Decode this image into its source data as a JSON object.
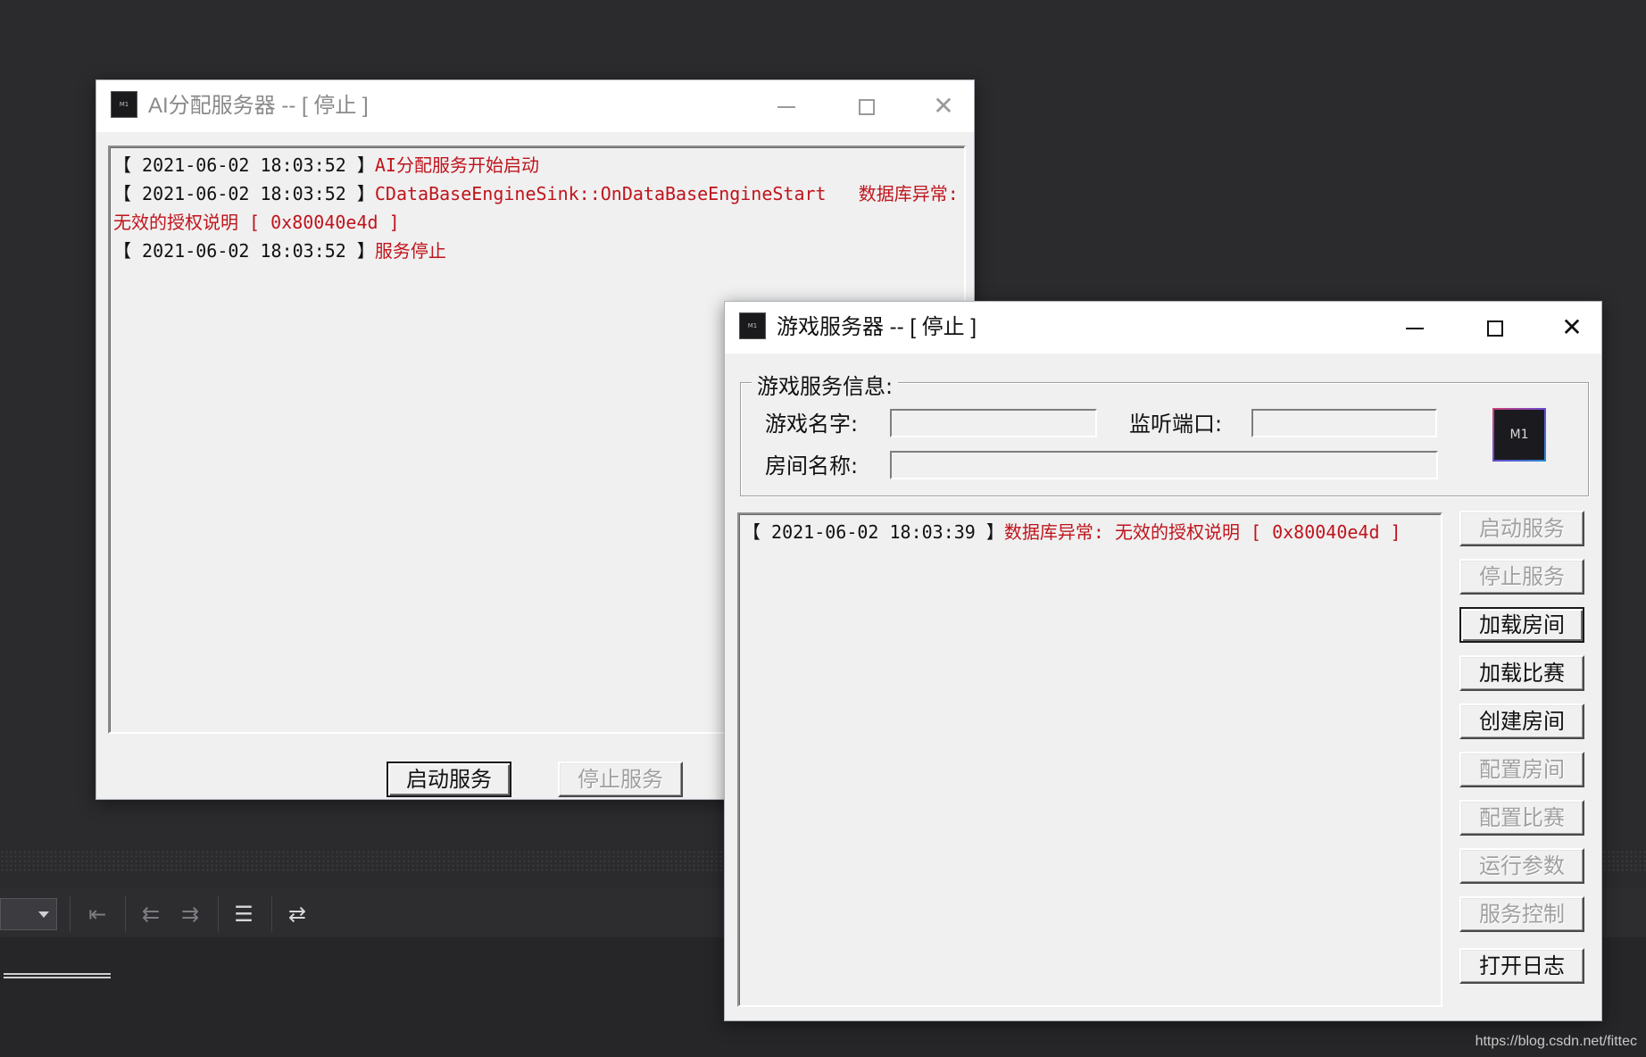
{
  "ai_window": {
    "title": "AI分配服务器 -- [ 停止 ]",
    "log": [
      {
        "ts": "【 2021-06-02 18:03:52 】",
        "msg": "AI分配服务开始启动"
      },
      {
        "ts": "【 2021-06-02 18:03:52 】",
        "msg": "CDataBaseEngineSink::OnDataBaseEngineStart   数据库异常: 无效的授权说明 [ 0x80040e4d ]"
      },
      {
        "ts": "【 2021-06-02 18:03:52 】",
        "msg": "服务停止"
      }
    ],
    "buttons": {
      "start": "启动服务",
      "stop": "停止服务"
    }
  },
  "game_window": {
    "title": "游戏服务器 -- [ 停止 ]",
    "group_title": "游戏服务信息:",
    "labels": {
      "game_name": "游戏名字:",
      "listen_port": "监听端口:",
      "room_name": "房间名称:"
    },
    "fields": {
      "game_name": "",
      "listen_port": "",
      "room_name": ""
    },
    "chip_label": "M1",
    "log": [
      {
        "ts": "【 2021-06-02 18:03:39 】",
        "msg": "数据库异常: 无效的授权说明 [ 0x80040e4d ]"
      }
    ],
    "buttons": {
      "start_service": "启动服务",
      "stop_service": "停止服务",
      "load_room": "加载房间",
      "load_match": "加载比赛",
      "create_room": "创建房间",
      "config_room": "配置房间",
      "config_match": "配置比赛",
      "run_params": "运行参数",
      "service_control": "服务控制",
      "open_log": "打开日志"
    }
  },
  "watermark": "https://blog.csdn.net/fittec",
  "colors": {
    "log_error": "#c0141c",
    "ide_background": "#2b2b2e"
  }
}
